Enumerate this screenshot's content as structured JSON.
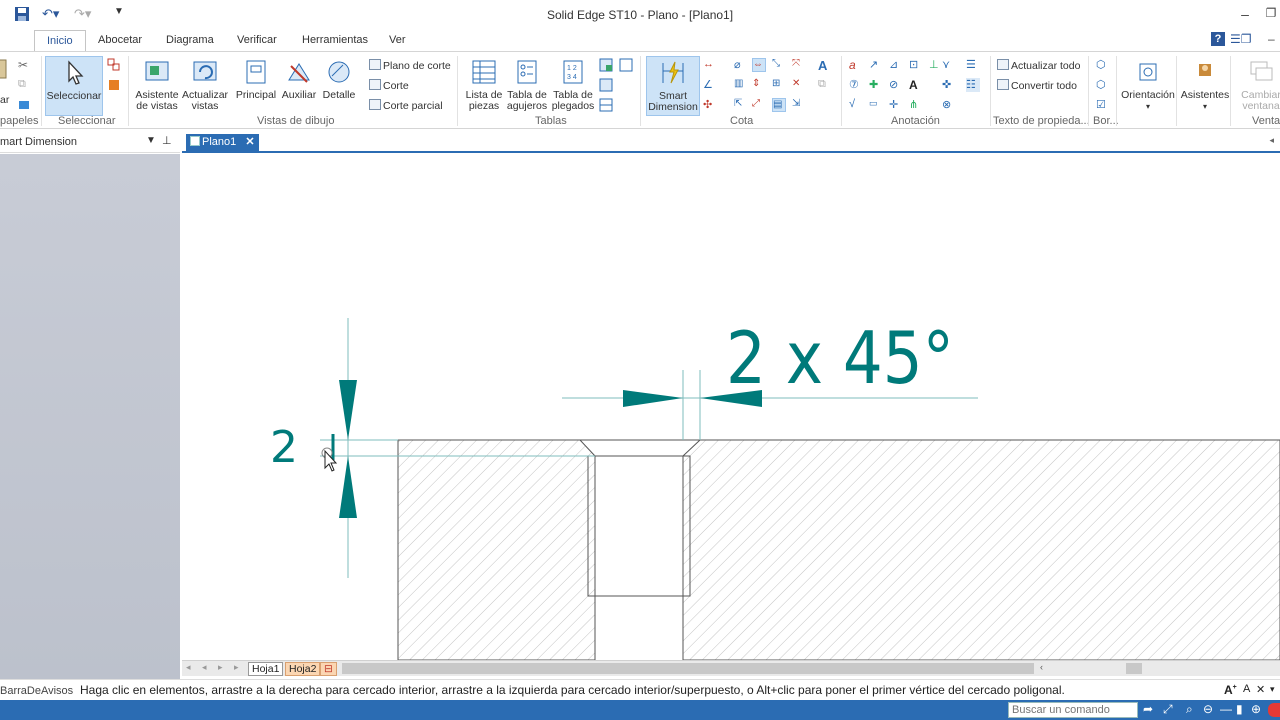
{
  "window": {
    "title": "Solid Edge ST10 - Plano - [Plano1]"
  },
  "tabs": [
    "Inicio",
    "Abocetar",
    "Diagrama",
    "Verificar",
    "Herramientas",
    "Ver"
  ],
  "ribbon": {
    "groups": {
      "papeles": "papeles",
      "seleccionar": "Seleccionar",
      "vistas": "Vistas de dibujo",
      "tablas": "Tablas",
      "cota": "Cota",
      "anotacion": "Anotación",
      "texto": "Texto de propieda...",
      "bor": "Bor...",
      "venta": "Venta"
    },
    "buttons": {
      "seleccionar": "Seleccionar",
      "asistente1": "Asistente",
      "asistente2": "de vistas",
      "actualizar1": "Actualizar",
      "actualizar2": "vistas",
      "principal": "Principal",
      "auxiliar": "Auxiliar",
      "detalle": "Detalle",
      "plano_corte": "Plano de corte",
      "corte": "Corte",
      "corte_parcial": "Corte parcial",
      "lista1": "Lista de",
      "lista2": "piezas",
      "tabla_ag1": "Tabla de",
      "tabla_ag2": "agujeros",
      "tabla_pl1": "Tabla de",
      "tabla_pl2": "plegados",
      "smart1": "Smart",
      "smart2": "Dimension",
      "actualizar_todo": "Actualizar todo",
      "convertir_todo": "Convertir todo",
      "orientacion": "Orientación",
      "asistentes": "Asistentes",
      "cambiar1": "Cambiar",
      "cambiar2": "ventana",
      "paste_cut": "ar"
    }
  },
  "panel": {
    "title": "mart Dimension"
  },
  "document": {
    "tab": "Plano1"
  },
  "drawing": {
    "chamfer_label": "2 x 45°",
    "dim_value": "2"
  },
  "sheets": [
    "Hoja1",
    "Hoja2"
  ],
  "status": {
    "left": "BarraDeAvisos",
    "message": "Haga clic en elementos, arrastre a la derecha para cercado interior, arrastre a la izquierda para cercado interior/superpuesto, o Alt+clic para poner el primer vértice del cercado poligonal."
  },
  "command_search": {
    "placeholder": "Buscar un comando"
  },
  "colors": {
    "accent": "#2b6cb3",
    "dimension": "#007a7a",
    "selected": "#cde3f7"
  }
}
